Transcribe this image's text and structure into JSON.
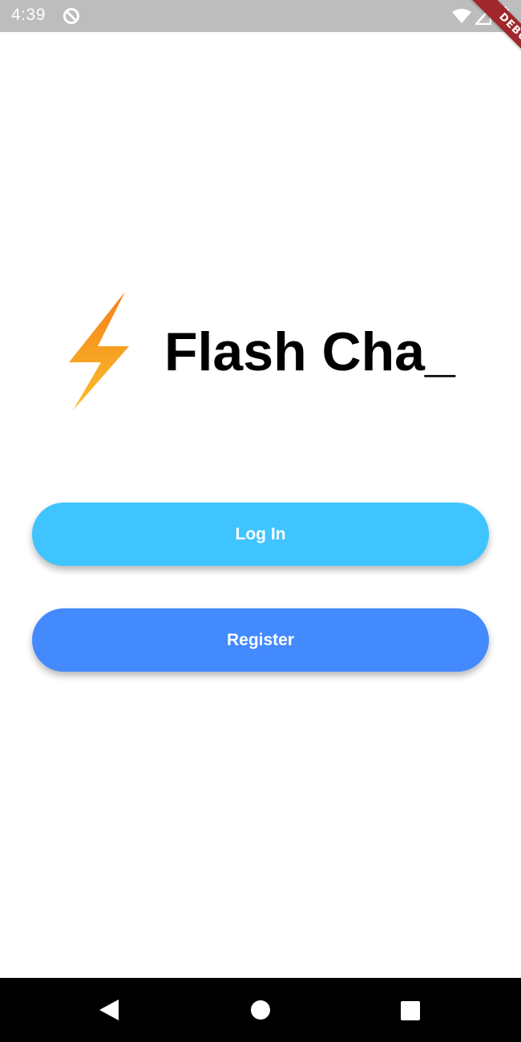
{
  "status_bar": {
    "time": "4:39",
    "icons": [
      "data-saver-icon",
      "wifi-icon",
      "cellular-signal-icon",
      "battery-icon"
    ]
  },
  "debug_banner": {
    "label": "DEBUG"
  },
  "logo": {
    "icon": "lightning-bolt-icon",
    "colors": [
      "#f57f17",
      "#fbc02d"
    ]
  },
  "title": "Flash Cha_",
  "buttons": {
    "login": {
      "label": "Log In",
      "color": "#40c4ff"
    },
    "register": {
      "label": "Register",
      "color": "#448aff"
    }
  },
  "nav_bar": {
    "icons": [
      "back-icon",
      "home-icon",
      "recents-icon"
    ]
  }
}
